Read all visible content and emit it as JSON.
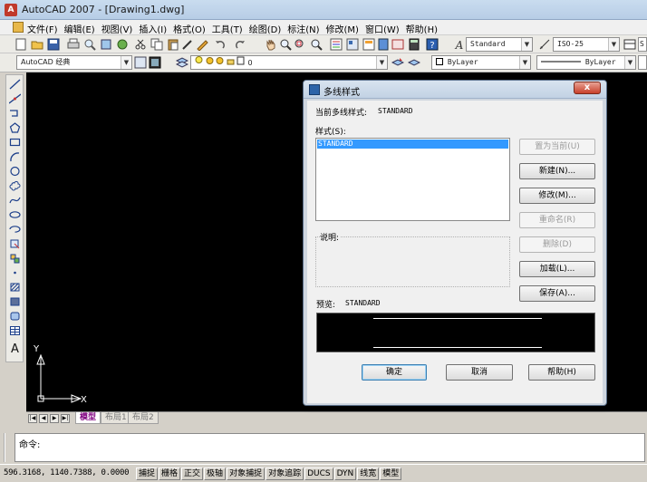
{
  "window": {
    "title": "AutoCAD 2007 - [Drawing1.dwg]",
    "app_icon_glyph": "A"
  },
  "menu": [
    "文件(F)",
    "编辑(E)",
    "视图(V)",
    "插入(I)",
    "格式(O)",
    "工具(T)",
    "绘图(D)",
    "标注(N)",
    "修改(M)",
    "窗口(W)",
    "帮助(H)"
  ],
  "toolbar1": {
    "text_style": "Standard",
    "dim_style": "ISO-25",
    "truncated_style": "S"
  },
  "toolbar2": {
    "workspace": "AutoCAD 经典",
    "layer": "0",
    "color": "ByLayer",
    "linetype": "ByLayer"
  },
  "layout_tabs": [
    "模型",
    "布局1",
    "布局2"
  ],
  "command": {
    "prompt": "命令:"
  },
  "status": {
    "coords": "596.3168,  1140.7388, 0.0000",
    "buttons": [
      "捕捉",
      "栅格",
      "正交",
      "极轴",
      "对象捕捉",
      "对象追踪",
      "DUCS",
      "DYN",
      "线宽",
      "模型"
    ]
  },
  "ucs": {
    "x_label": "X",
    "y_label": "Y"
  },
  "dialog": {
    "title": "多线样式",
    "current_style_label": "当前多线样式:",
    "current_style_value": "STANDARD",
    "styles_label": "样式(S):",
    "styles": [
      "STANDARD"
    ],
    "description_label": "说明:",
    "preview_label": "预览:",
    "preview_value": "STANDARD",
    "buttons": {
      "set_current": "置为当前(U)",
      "new": "新建(N)...",
      "modify": "修改(M)...",
      "rename": "重命名(R)",
      "delete": "删除(D)",
      "load": "加载(L)...",
      "save": "保存(A)...",
      "ok": "确定",
      "cancel": "取消",
      "help": "帮助(H)"
    },
    "close_glyph": "x"
  },
  "colors": {
    "canvas": "#000000",
    "selection": "#3399ff",
    "active_tab": "#800080"
  }
}
